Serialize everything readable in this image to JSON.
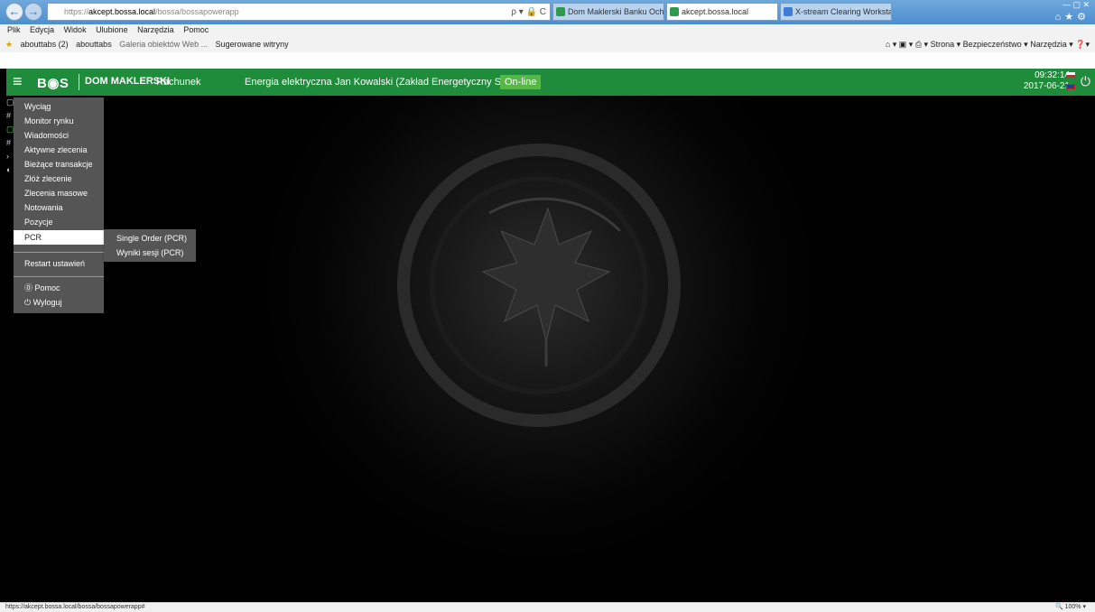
{
  "browser": {
    "url_prefix": "https://",
    "url_domain": "akcept.bossa.local",
    "url_path": "/bossa/bossapowerapp",
    "address_tools": "ρ ▾ 🔒 C",
    "tabs": [
      {
        "label": "Dom Maklerski Banku Ochron..."
      },
      {
        "label": "akcept.bossa.local"
      },
      {
        "label": "X-stream Clearing Workstation"
      }
    ],
    "menu": [
      "Plik",
      "Edycja",
      "Widok",
      "Ulubione",
      "Narzędzia",
      "Pomoc"
    ],
    "favorites": [
      "abouttabs (2)",
      "abouttabs",
      "Galeria obiektów Web ...",
      "Sugerowane witryny"
    ],
    "commands": [
      "Strona",
      "Bezpieczeństwo",
      "Narzędzia"
    ],
    "status_url": "https://akcept.bossa.local/bossa/bossapowerapp#",
    "zoom": "100%"
  },
  "app": {
    "logo": "B◉S",
    "brand": "DOM MAKLERSKI",
    "header_items": [
      "Rachunek",
      "Energia elektryczna",
      "Jan Kowalski (Zakład Energetyczny S.A.)"
    ],
    "status": "On-line",
    "time": "09:32:14",
    "date": "2017-06-21"
  },
  "menu": {
    "items": [
      "Wyciąg",
      "Monitor rynku",
      "Wiadomości",
      "Aktywne zlecenia",
      "Bieżące transakcje",
      "Złóż zlecenie",
      "Zlecenia masowe",
      "Notowania",
      "Pozycje",
      "PCR"
    ],
    "restart": "Restart ustawień",
    "help": "Pomoc",
    "logout": "Wyloguj",
    "selected": "PCR"
  },
  "submenu": {
    "items": [
      "Single Order (PCR)",
      "Wyniki sesji (PCR)"
    ]
  },
  "colors": {
    "header_green": "#1f8c3b",
    "online_green": "#56b947",
    "menu_bg": "#555555"
  }
}
